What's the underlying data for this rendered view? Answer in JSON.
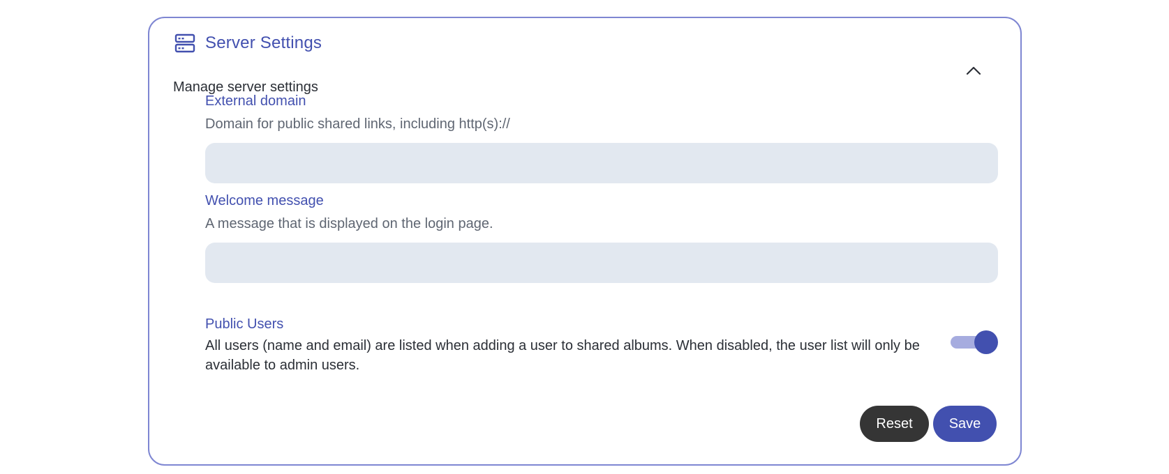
{
  "section": {
    "icon": "server-icon",
    "title": "Server Settings",
    "subtitle": "Manage server settings",
    "collapse_icon": "chevron-up-icon"
  },
  "fields": [
    {
      "label": "External domain",
      "description": "Domain for public shared links, including http(s)://",
      "value": "",
      "placeholder": ""
    },
    {
      "label": "Welcome message",
      "description": "A message that is displayed on the login page.",
      "value": "",
      "placeholder": ""
    }
  ],
  "public_users": {
    "label": "Public Users",
    "description": "All users (name and email) are listed when adding a user to shared albums. When disabled, the user list will only be available to admin users.",
    "enabled": true
  },
  "actions": {
    "reset_label": "Reset",
    "save_label": "Save"
  },
  "colors": {
    "accent": "#4250af",
    "card_border": "#7e86d2",
    "input_bg": "#e2e8f0",
    "reset_bg": "#353535"
  }
}
